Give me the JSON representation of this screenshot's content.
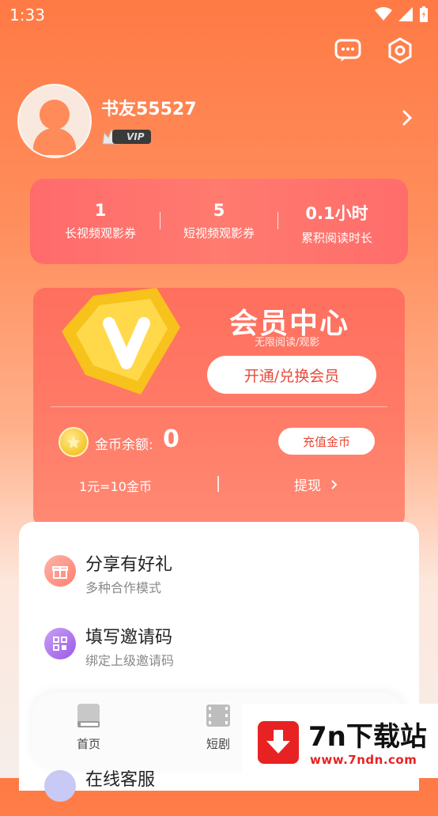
{
  "status_bar": {
    "time": "1:33"
  },
  "profile": {
    "username": "书友55527",
    "vip_label": "VIP"
  },
  "stats": [
    {
      "value": "1",
      "label": "长视频观影券"
    },
    {
      "value": "5",
      "label": "短视频观影券"
    },
    {
      "value": "0.1小时",
      "label": "累积阅读时长"
    }
  ],
  "vip_center": {
    "title": "会员中心",
    "subtitle": "无限阅读/观影",
    "open_button": "开通/兑换会员",
    "coin_label": "金币余额:",
    "coin_value": "0",
    "recharge_button": "充值金币",
    "rate": "1元=10金币",
    "withdraw": "提现"
  },
  "menu": [
    {
      "title": "分享有好礼",
      "subtitle": "多种合作模式",
      "icon": "gift-icon"
    },
    {
      "title": "填写邀请码",
      "subtitle": "绑定上级邀请码",
      "icon": "qr-code-icon"
    },
    {
      "title": "在线客服",
      "icon": "headset-icon"
    }
  ],
  "bottom_nav": [
    {
      "label": "首页",
      "icon": "book-icon"
    },
    {
      "label": "短剧",
      "icon": "film-icon"
    }
  ],
  "watermark": {
    "title": "7n下载站",
    "url": "www.7ndn.com"
  },
  "colors": {
    "accent": "#ff6f5e",
    "button_text": "#e84a3a",
    "watermark_red": "#e82222"
  }
}
